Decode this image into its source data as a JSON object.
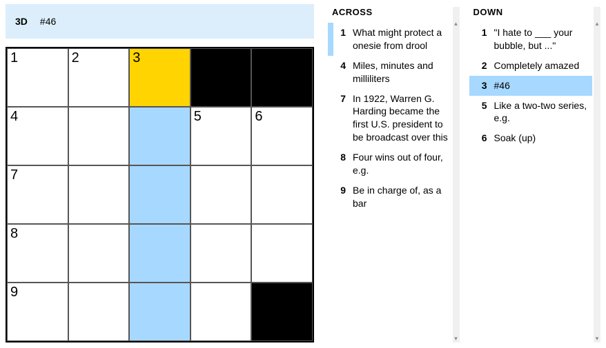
{
  "currentClue": {
    "label": "3D",
    "text": "#46"
  },
  "grid": {
    "rows": 5,
    "cols": 5,
    "cells": [
      [
        {
          "num": "1"
        },
        {
          "num": "2"
        },
        {
          "num": "3",
          "state": "cursor"
        },
        {
          "state": "black"
        },
        {
          "state": "black"
        }
      ],
      [
        {
          "num": "4"
        },
        {},
        {
          "state": "hl"
        },
        {
          "num": "5"
        },
        {
          "num": "6"
        }
      ],
      [
        {
          "num": "7"
        },
        {},
        {
          "state": "hl"
        },
        {},
        {}
      ],
      [
        {
          "num": "8"
        },
        {},
        {
          "state": "hl"
        },
        {},
        {}
      ],
      [
        {
          "num": "9"
        },
        {},
        {
          "state": "hl"
        },
        {},
        {
          "state": "black"
        }
      ]
    ]
  },
  "clues": {
    "across": {
      "heading": "ACROSS",
      "list": [
        {
          "n": "1",
          "t": "What might protect a onesie from drool",
          "active": "border"
        },
        {
          "n": "4",
          "t": "Miles, minutes and milliliters"
        },
        {
          "n": "7",
          "t": "In 1922, Warren G. Harding became the first U.S. president to be broadcast over this"
        },
        {
          "n": "8",
          "t": "Four wins out of four, e.g."
        },
        {
          "n": "9",
          "t": "Be in charge of, as a bar"
        }
      ]
    },
    "down": {
      "heading": "DOWN",
      "list": [
        {
          "n": "1",
          "t": "\"I hate to ___ your bubble, but ...\""
        },
        {
          "n": "2",
          "t": "Completely amazed"
        },
        {
          "n": "3",
          "t": "#46",
          "active": "fill"
        },
        {
          "n": "5",
          "t": "Like a two-two series, e.g."
        },
        {
          "n": "6",
          "t": "Soak (up)"
        }
      ]
    }
  }
}
